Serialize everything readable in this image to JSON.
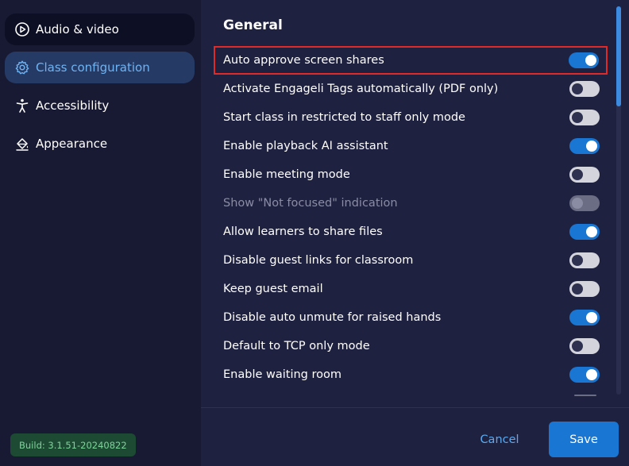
{
  "sidebar": {
    "items": [
      {
        "label": "Audio & video",
        "icon": "play-circle-icon"
      },
      {
        "label": "Class configuration",
        "icon": "gear-icon"
      },
      {
        "label": "Accessibility",
        "icon": "accessibility-icon"
      },
      {
        "label": "Appearance",
        "icon": "paint-bucket-icon"
      }
    ],
    "active_index": 1
  },
  "build": {
    "label": "Build: 3.1.51-20240822"
  },
  "main": {
    "section_title": "General",
    "settings": [
      {
        "label": "Auto approve screen shares",
        "on": true
      },
      {
        "label": "Activate Engageli Tags automatically (PDF only)",
        "on": false
      },
      {
        "label": "Start class in restricted to staff only mode",
        "on": false
      },
      {
        "label": "Enable playback AI assistant",
        "on": true
      },
      {
        "label": "Enable meeting mode",
        "on": false
      },
      {
        "label": "Show \"Not focused\" indication",
        "on": false,
        "disabled": true
      },
      {
        "label": "Allow learners to share files",
        "on": true
      },
      {
        "label": "Disable guest links for classroom",
        "on": false
      },
      {
        "label": "Keep guest email",
        "on": false
      },
      {
        "label": "Disable auto unmute for raised hands",
        "on": true
      },
      {
        "label": "Default to TCP only mode",
        "on": false
      },
      {
        "label": "Enable waiting room",
        "on": true
      }
    ]
  },
  "footer": {
    "cancel_label": "Cancel",
    "save_label": "Save"
  },
  "colors": {
    "accent": "#1976d2",
    "highlight_border": "#e02a2a",
    "active_nav_text": "#6fb3f2"
  }
}
